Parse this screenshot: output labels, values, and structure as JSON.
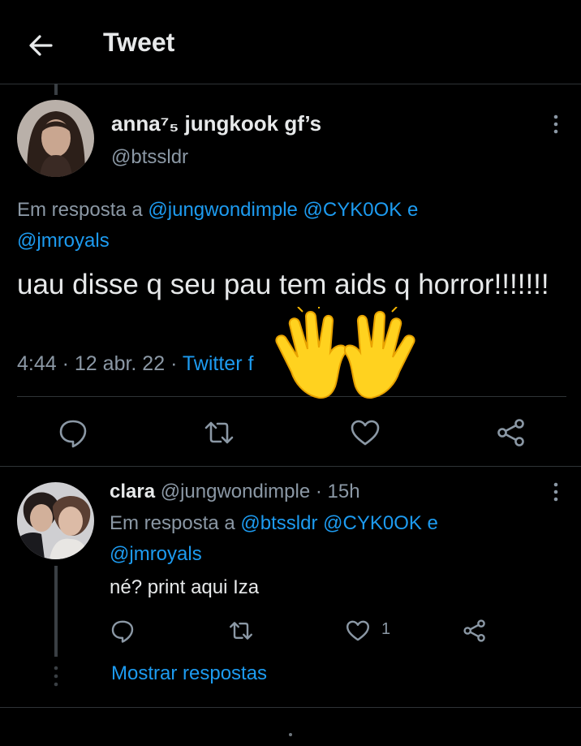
{
  "header": {
    "title": "Tweet",
    "back_icon": "arrow-left-icon"
  },
  "main_tweet": {
    "display_name": "anna⁷₅ jungkook gf’s",
    "handle": "@btssldr",
    "reply_prefix": "Em resposta a",
    "reply_mentions": [
      "@jungwondimple",
      "@CYK0OK"
    ],
    "reply_and": "e",
    "reply_last": "@jmroyals",
    "text": "uau disse q seu pau tem aids q horror!!!!!!!",
    "time": "4:44",
    "sep": "·",
    "date": "12 abr. 22",
    "source": "Twitter f",
    "overlay_emoji": "raising-hands-emoji",
    "actions": [
      "reply-icon",
      "retweet-icon",
      "like-icon",
      "share-icon"
    ]
  },
  "reply_tweet": {
    "display_name": "clara",
    "handle": "@jungwondimple",
    "sep": "·",
    "age": "15h",
    "reply_prefix": "Em resposta a",
    "reply_mentions": [
      "@btssldr",
      "@CYK0OK"
    ],
    "reply_and": "e",
    "reply_last": "@jmroyals",
    "text": "né? print aqui Iza",
    "like_count": "1",
    "show_replies": "Mostrar respostas"
  },
  "colors": {
    "background": "#000000",
    "text": "#e7e9ea",
    "secondary": "#8b98a5",
    "accent": "#1d9bf0",
    "divider": "#2f3336"
  }
}
